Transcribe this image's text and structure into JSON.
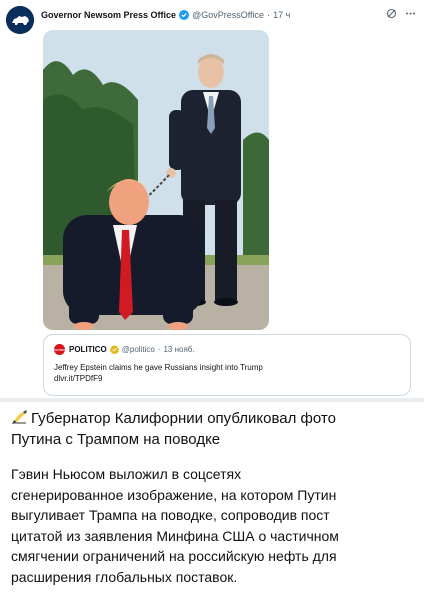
{
  "tweet": {
    "author_name": "Governor Newsom Press Office",
    "handle": "@GovPressOffice",
    "separator": "·",
    "time": "17 ч",
    "avatar_icon": "bear-icon",
    "verified_icon": "verified-badge-icon",
    "actions": [
      "grok-icon",
      "more-icon"
    ],
    "image_description_icon": "photo",
    "quote": {
      "source_name": "POLITICO",
      "source_logo_text": "POLITICO",
      "handle": "@politico",
      "separator": "·",
      "time": "13 нояб.",
      "text_line1": "Jeffrey Epstein claims he gave Russians insight into Trump",
      "text_line2": "dlvr.it/TPDfF9"
    }
  },
  "article": {
    "headline_icon": "writing-hand-icon",
    "headline_line1": "Губернатор Калифорнии опубликовал фото",
    "headline_line2": "Путина с Трампом на поводке",
    "body_lines": [
      "Гэвин Ньюсом выложил в соцсетях",
      "сгенерированное изображение, на котором Путин",
      "выгуливает Трампа на поводке, сопроводив пост",
      "цитатой из заявления Минфина США о частичном",
      "смягчении ограничений на российскую нефть для",
      "расширения глобальных поставок."
    ]
  },
  "colors": {
    "verified_blue": "#1d9bf0",
    "politico_red": "#d6131b",
    "avatar_navy": "#0b2f5c",
    "divider_gray": "#e9edf1"
  }
}
